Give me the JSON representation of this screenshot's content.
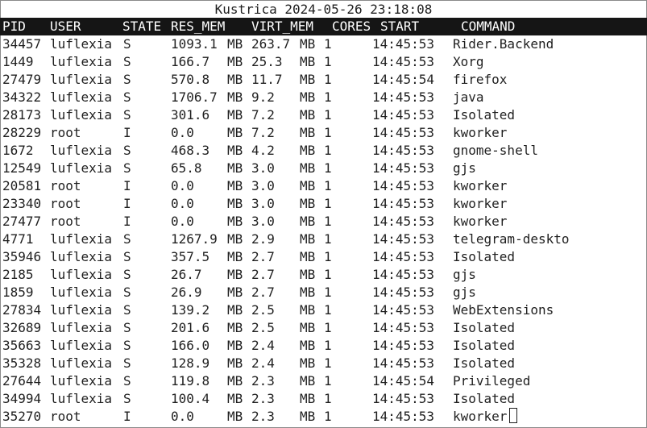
{
  "window": {
    "title": "Kustrica 2024-05-26 23:18:08"
  },
  "headers": {
    "pid": "PID",
    "user": "USER",
    "state": "STATE",
    "res_mem": "RES_MEM",
    "virt_mem": "VIRT_MEM",
    "cores": "CORES",
    "start": "START",
    "command": "COMMAND"
  },
  "rows": [
    {
      "pid": "34457",
      "user": "luflexia",
      "state": "S",
      "res": "1093.1",
      "res_unit": "MB",
      "virt": "263.7",
      "virt_unit": "MB",
      "cores": "1",
      "start": "14:45:53",
      "command": "Rider.Backend"
    },
    {
      "pid": "1449",
      "user": "luflexia",
      "state": "S",
      "res": "166.7",
      "res_unit": "MB",
      "virt": "25.3",
      "virt_unit": "MB",
      "cores": "1",
      "start": "14:45:53",
      "command": "Xorg"
    },
    {
      "pid": "27479",
      "user": "luflexia",
      "state": "S",
      "res": "570.8",
      "res_unit": "MB",
      "virt": "11.7",
      "virt_unit": "MB",
      "cores": "1",
      "start": "14:45:54",
      "command": "firefox"
    },
    {
      "pid": "34322",
      "user": "luflexia",
      "state": "S",
      "res": "1706.7",
      "res_unit": "MB",
      "virt": "9.2",
      "virt_unit": "MB",
      "cores": "1",
      "start": "14:45:53",
      "command": "java"
    },
    {
      "pid": "28173",
      "user": "luflexia",
      "state": "S",
      "res": "301.6",
      "res_unit": "MB",
      "virt": "7.2",
      "virt_unit": "MB",
      "cores": "1",
      "start": "14:45:53",
      "command": "Isolated"
    },
    {
      "pid": "28229",
      "user": "root",
      "state": "I",
      "res": "0.0",
      "res_unit": "MB",
      "virt": "7.2",
      "virt_unit": "MB",
      "cores": "1",
      "start": "14:45:53",
      "command": "kworker"
    },
    {
      "pid": "1672",
      "user": "luflexia",
      "state": "S",
      "res": "468.3",
      "res_unit": "MB",
      "virt": "4.2",
      "virt_unit": "MB",
      "cores": "1",
      "start": "14:45:53",
      "command": "gnome-shell"
    },
    {
      "pid": "12549",
      "user": "luflexia",
      "state": "S",
      "res": "65.8",
      "res_unit": "MB",
      "virt": "3.0",
      "virt_unit": "MB",
      "cores": "1",
      "start": "14:45:53",
      "command": "gjs"
    },
    {
      "pid": "20581",
      "user": "root",
      "state": "I",
      "res": "0.0",
      "res_unit": "MB",
      "virt": "3.0",
      "virt_unit": "MB",
      "cores": "1",
      "start": "14:45:53",
      "command": "kworker"
    },
    {
      "pid": "23340",
      "user": "root",
      "state": "I",
      "res": "0.0",
      "res_unit": "MB",
      "virt": "3.0",
      "virt_unit": "MB",
      "cores": "1",
      "start": "14:45:53",
      "command": "kworker"
    },
    {
      "pid": "27477",
      "user": "root",
      "state": "I",
      "res": "0.0",
      "res_unit": "MB",
      "virt": "3.0",
      "virt_unit": "MB",
      "cores": "1",
      "start": "14:45:53",
      "command": "kworker"
    },
    {
      "pid": "4771",
      "user": "luflexia",
      "state": "S",
      "res": "1267.9",
      "res_unit": "MB",
      "virt": "2.9",
      "virt_unit": "MB",
      "cores": "1",
      "start": "14:45:53",
      "command": "telegram-deskto"
    },
    {
      "pid": "35946",
      "user": "luflexia",
      "state": "S",
      "res": "357.5",
      "res_unit": "MB",
      "virt": "2.7",
      "virt_unit": "MB",
      "cores": "1",
      "start": "14:45:53",
      "command": "Isolated"
    },
    {
      "pid": "2185",
      "user": "luflexia",
      "state": "S",
      "res": "26.7",
      "res_unit": "MB",
      "virt": "2.7",
      "virt_unit": "MB",
      "cores": "1",
      "start": "14:45:53",
      "command": "gjs"
    },
    {
      "pid": "1859",
      "user": "luflexia",
      "state": "S",
      "res": "26.9",
      "res_unit": "MB",
      "virt": "2.7",
      "virt_unit": "MB",
      "cores": "1",
      "start": "14:45:53",
      "command": "gjs"
    },
    {
      "pid": "27834",
      "user": "luflexia",
      "state": "S",
      "res": "139.2",
      "res_unit": "MB",
      "virt": "2.5",
      "virt_unit": "MB",
      "cores": "1",
      "start": "14:45:53",
      "command": "WebExtensions"
    },
    {
      "pid": "32689",
      "user": "luflexia",
      "state": "S",
      "res": "201.6",
      "res_unit": "MB",
      "virt": "2.5",
      "virt_unit": "MB",
      "cores": "1",
      "start": "14:45:53",
      "command": "Isolated"
    },
    {
      "pid": "35663",
      "user": "luflexia",
      "state": "S",
      "res": "166.0",
      "res_unit": "MB",
      "virt": "2.4",
      "virt_unit": "MB",
      "cores": "1",
      "start": "14:45:53",
      "command": "Isolated"
    },
    {
      "pid": "35328",
      "user": "luflexia",
      "state": "S",
      "res": "128.9",
      "res_unit": "MB",
      "virt": "2.4",
      "virt_unit": "MB",
      "cores": "1",
      "start": "14:45:53",
      "command": "Isolated"
    },
    {
      "pid": "27644",
      "user": "luflexia",
      "state": "S",
      "res": "119.8",
      "res_unit": "MB",
      "virt": "2.3",
      "virt_unit": "MB",
      "cores": "1",
      "start": "14:45:54",
      "command": "Privileged"
    },
    {
      "pid": "34994",
      "user": "luflexia",
      "state": "S",
      "res": "100.4",
      "res_unit": "MB",
      "virt": "2.3",
      "virt_unit": "MB",
      "cores": "1",
      "start": "14:45:53",
      "command": "Isolated"
    },
    {
      "pid": "35270",
      "user": "root",
      "state": "I",
      "res": "0.0",
      "res_unit": "MB",
      "virt": "2.3",
      "virt_unit": "MB",
      "cores": "1",
      "start": "14:45:53",
      "command": "kworker"
    }
  ]
}
